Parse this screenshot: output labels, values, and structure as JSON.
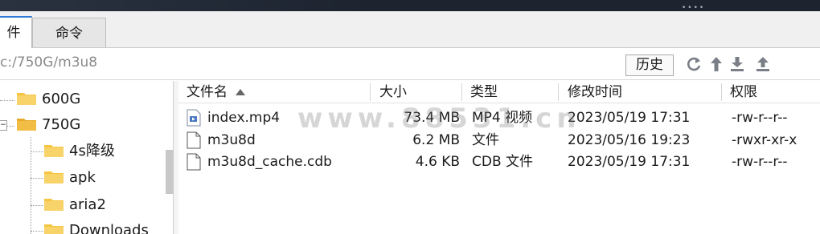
{
  "tabs": [
    {
      "label": "件"
    },
    {
      "label": "命令"
    }
  ],
  "address": {
    "path": "c:/750G/m3u8"
  },
  "toolbar": {
    "history_label": "历史"
  },
  "tree": {
    "items": [
      {
        "label": "600G"
      },
      {
        "label": "750G"
      },
      {
        "label": "4s降级"
      },
      {
        "label": "apk"
      },
      {
        "label": "aria2"
      },
      {
        "label": "Downloads"
      }
    ]
  },
  "file_list": {
    "columns": [
      {
        "label": "文件名"
      },
      {
        "label": "大小"
      },
      {
        "label": "类型"
      },
      {
        "label": "修改时间"
      },
      {
        "label": "权限"
      }
    ],
    "rows": [
      {
        "name": "index.mp4",
        "size": "73.4 MB",
        "type": "MP4 视频",
        "modified": "2023/05/19 17:31",
        "perm": "-rw-r--r--"
      },
      {
        "name": "m3u8d",
        "size": "6.2 MB",
        "type": "文件",
        "modified": "2023/05/16 19:23",
        "perm": "-rwxr-xr-x"
      },
      {
        "name": "m3u8d_cache.cdb",
        "size": "4.6 KB",
        "type": "CDB 文件",
        "modified": "2023/05/19 17:31",
        "perm": "-rw-r--r--"
      }
    ]
  },
  "watermark": {
    "text": "www.88531.cn"
  },
  "colors": {
    "accent": "#2f7bd6",
    "folder": "#f5c542",
    "topbar": "#1d2430"
  }
}
